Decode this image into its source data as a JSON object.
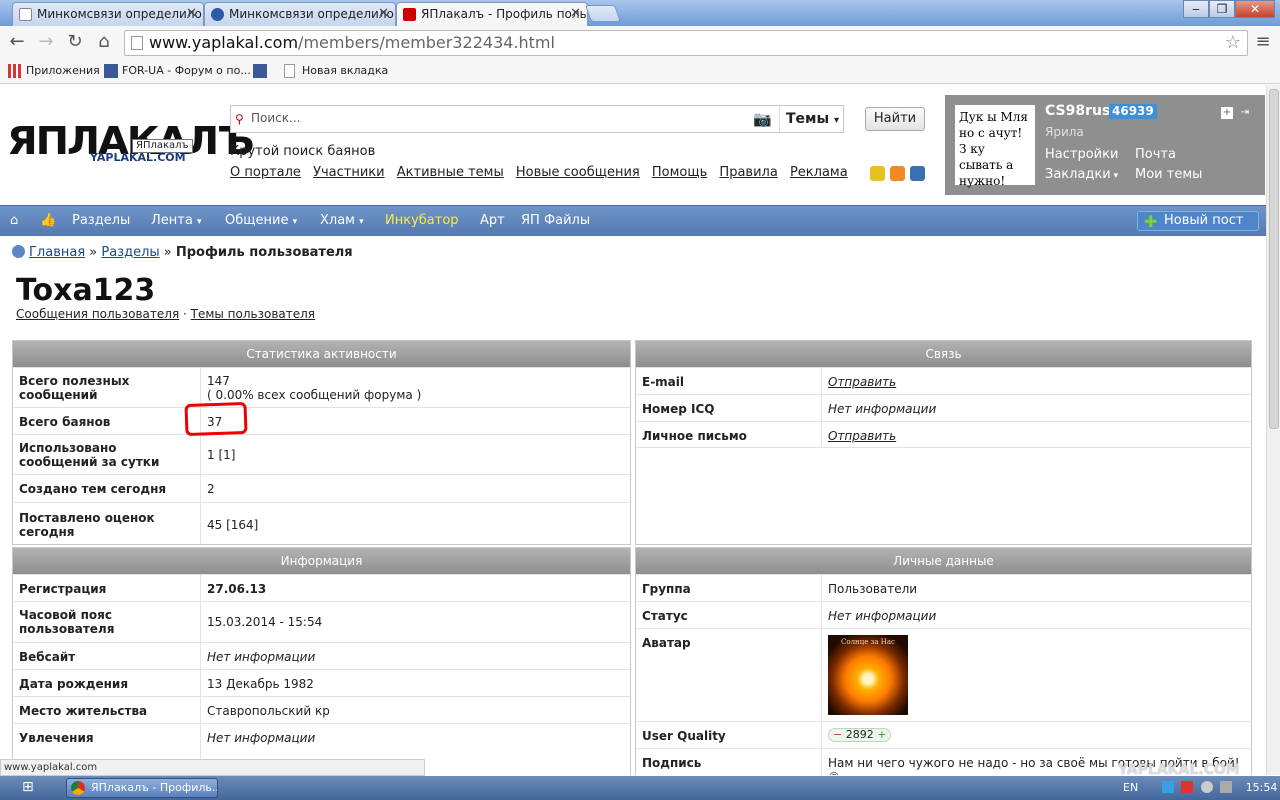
{
  "browser": {
    "tabs": [
      {
        "title": "Минкомсвязи определило"
      },
      {
        "title": "Минкомсвязи определило"
      },
      {
        "title": "ЯПлакалъ - Профиль польз"
      }
    ],
    "address": {
      "host": "www.yaplakal.com",
      "path": "/members/member322434.html"
    },
    "bookmarks": [
      "Приложения",
      "FOR-UA - Форум о по...",
      "Новая вкладка"
    ]
  },
  "header": {
    "logo_text": "ЯПЛАКАЛЪ",
    "logo_sub": "YAPLAKAL.COM",
    "logo_tooltip": "ЯПлакалъ",
    "search_placeholder": "Поиск...",
    "search_scope": "Темы",
    "find_button": "Найти",
    "slogan": "Крутой поиск баянов",
    "menu": [
      "О портале",
      "Участники",
      "Активные темы",
      "Новые сообщения",
      "Помощь",
      "Правила",
      "Реклама"
    ]
  },
  "userbox": {
    "avatar_text": "Дук ы Мля но с ачут! З ку сывать а нужно!",
    "name": "CS98rus",
    "reputation": "46939",
    "rank": "Ярила",
    "links": [
      "Настройки",
      "Почта",
      "Закладки",
      "Мои темы"
    ]
  },
  "nav": {
    "items": [
      "Разделы",
      "Лента",
      "Общение",
      "Хлам",
      "Инкубатор",
      "Арт",
      "ЯП Файлы"
    ],
    "new_post": "Новый пост"
  },
  "breadcrumb": {
    "home": "Главная",
    "sections": "Разделы",
    "current": "Профиль пользователя"
  },
  "profile": {
    "username": "Toxa123",
    "links": [
      "Сообщения пользователя",
      "Темы пользователя"
    ],
    "activity": {
      "title": "Статистика активности",
      "rows": [
        {
          "label": "Всего полезных сообщений",
          "value": "147",
          "note": "( 0.00% всех сообщений форума )"
        },
        {
          "label": "Всего баянов",
          "value": "37"
        },
        {
          "label": "Использовано сообщений за сутки",
          "value": "1 [1]"
        },
        {
          "label": "Создано тем сегодня",
          "value": "2"
        },
        {
          "label": "Поставлено оценок сегодня",
          "value": "45 [164]"
        }
      ]
    },
    "contact": {
      "title": "Связь",
      "rows": [
        {
          "label": "E-mail",
          "value": "Отправить"
        },
        {
          "label": "Номер ICQ",
          "value": "Нет информации"
        },
        {
          "label": "Личное письмо",
          "value": "Отправить"
        }
      ]
    },
    "info": {
      "title": "Информация",
      "rows": [
        {
          "label": "Регистрация",
          "value": "27.06.13"
        },
        {
          "label": "Часовой пояс пользователя",
          "value": "15.03.2014 - 15:54"
        },
        {
          "label": "Вебсайт",
          "value": "Нет информации"
        },
        {
          "label": "Дата рождения",
          "value": "13 Декабрь 1982"
        },
        {
          "label": "Место жительства",
          "value": "Ставропольский кр"
        },
        {
          "label": "Увлечения",
          "value": "Нет информации"
        }
      ]
    },
    "personal": {
      "title": "Личные данные",
      "rows": [
        {
          "label": "Группа",
          "value": "Пользователи"
        },
        {
          "label": "Статус",
          "value": "Нет информации"
        },
        {
          "label": "Аватар",
          "value": "Солнце за Нас"
        },
        {
          "label": "User Quality",
          "value": "2892"
        },
        {
          "label": "Подпись",
          "value": "Нам ни чего чужого не надо - но за своё мы готовы пойти в бой! ©"
        }
      ]
    }
  },
  "status_url": "www.yaplakal.com",
  "watermark": "YAPLAKAL.COM",
  "taskbar": {
    "item": "ЯПлакалъ - Профиль...",
    "lang": "EN",
    "clock": "15:54"
  }
}
